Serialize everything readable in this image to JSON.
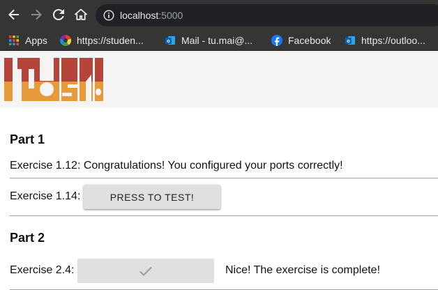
{
  "browser": {
    "url_host": "localhost",
    "url_port": ":5000",
    "bookmarks": [
      {
        "label": "Apps",
        "icon": "apps-grid-icon"
      },
      {
        "label": "https://studen...",
        "icon": "colorful-wheel-icon"
      },
      {
        "label": "Mail - tu.mai@...",
        "icon": "outlook-icon"
      },
      {
        "label": "Facebook",
        "icon": "facebook-icon"
      },
      {
        "label": "https://outloo...",
        "icon": "outlook-icon"
      }
    ]
  },
  "logo": {
    "text": "itoska"
  },
  "part1": {
    "heading": "Part 1",
    "ex112_text": "Exercise 1.12: Congratulations! You configured your ports correctly!",
    "ex114_label": "Exercise 1.14:",
    "ex114_button": "PRESS TO TEST!"
  },
  "part2": {
    "heading": "Part 2",
    "ex24_label": "Exercise 2.4:",
    "ex24_status": "Nice! The exercise is complete!"
  },
  "colors": {
    "chrome_bg": "#353535",
    "omnibox_bg": "#202124",
    "logo_red": "#b5453a",
    "logo_orange": "#e79a3a"
  }
}
